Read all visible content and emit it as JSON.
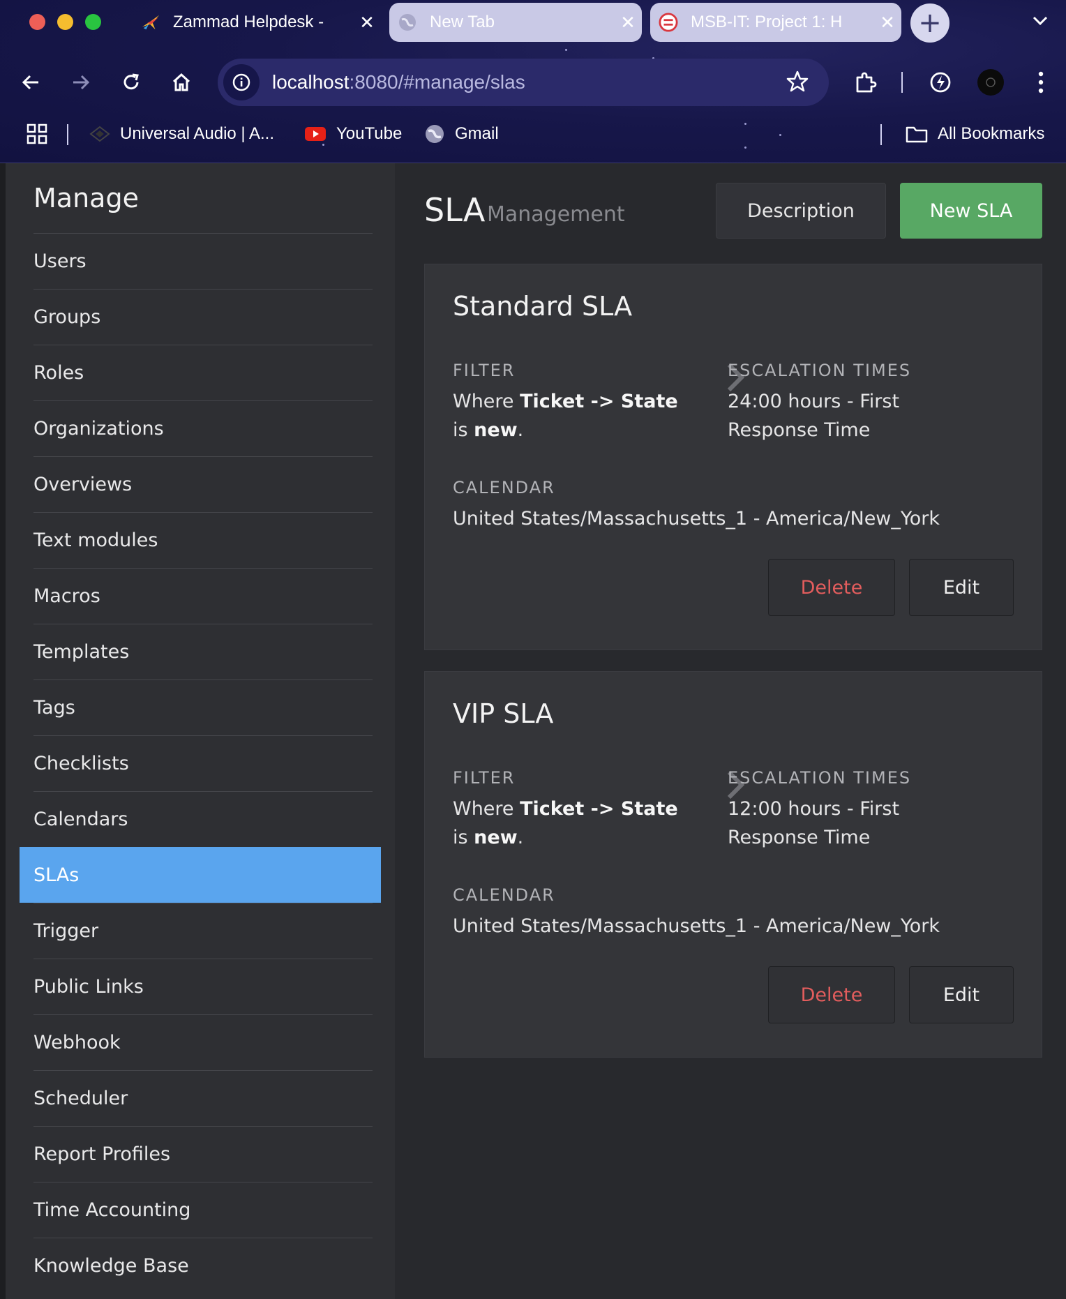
{
  "browser": {
    "tabs": [
      {
        "title": "Zammad Helpdesk - ",
        "favicon": "zammad-bird-icon",
        "active": true
      },
      {
        "title": "New Tab",
        "favicon": "globe-icon",
        "active": false
      },
      {
        "title": "MSB-IT: Project 1: H",
        "favicon": "msb-icon",
        "active": false
      }
    ],
    "url_host": "localhost",
    "url_path": ":8080/#manage/slas",
    "bookmarks": [
      {
        "label": "Universal Audio | A...",
        "icon": "universal-audio-icon"
      },
      {
        "label": "YouTube",
        "icon": "youtube-icon"
      },
      {
        "label": "Gmail",
        "icon": "globe-icon"
      }
    ],
    "all_bookmarks_label": "All Bookmarks"
  },
  "sidebar": {
    "title": "Manage",
    "items": [
      {
        "label": "Users"
      },
      {
        "label": "Groups"
      },
      {
        "label": "Roles"
      },
      {
        "label": "Organizations"
      },
      {
        "label": "Overviews"
      },
      {
        "label": "Text modules"
      },
      {
        "label": "Macros"
      },
      {
        "label": "Templates"
      },
      {
        "label": "Tags"
      },
      {
        "label": "Checklists"
      },
      {
        "label": "Calendars"
      },
      {
        "label": "SLAs",
        "active": true
      },
      {
        "label": "Trigger"
      },
      {
        "label": "Public Links"
      },
      {
        "label": "Webhook"
      },
      {
        "label": "Scheduler"
      },
      {
        "label": "Report Profiles"
      },
      {
        "label": "Time Accounting"
      },
      {
        "label": "Knowledge Base"
      }
    ]
  },
  "main": {
    "title": "SLA",
    "subtitle": "Management",
    "description_button": "Description",
    "new_button": "New SLA",
    "labels": {
      "filter": "FILTER",
      "escalation": "ESCALATION TIMES",
      "calendar": "CALENDAR",
      "delete": "Delete",
      "edit": "Edit"
    },
    "slas": [
      {
        "name": "Standard SLA",
        "filter_prefix": "Where ",
        "filter_attr": "Ticket -> State",
        "filter_op": " is ",
        "filter_value": "new",
        "filter_suffix": ".",
        "escalation_line1": "24:00 hours - First",
        "escalation_line2": "Response Time",
        "calendar": "United States/Massachusetts_1 - America/New_York"
      },
      {
        "name": "VIP SLA",
        "filter_prefix": "Where ",
        "filter_attr": "Ticket -> State",
        "filter_op": " is ",
        "filter_value": "new",
        "filter_suffix": ".",
        "escalation_line1": "12:00 hours - First",
        "escalation_line2": "Response Time",
        "calendar": "United States/Massachusetts_1 - America/New_York"
      }
    ]
  },
  "colors": {
    "active_nav": "#5aa5ee",
    "new_button": "#58a864",
    "delete_text": "#e35d5d"
  }
}
